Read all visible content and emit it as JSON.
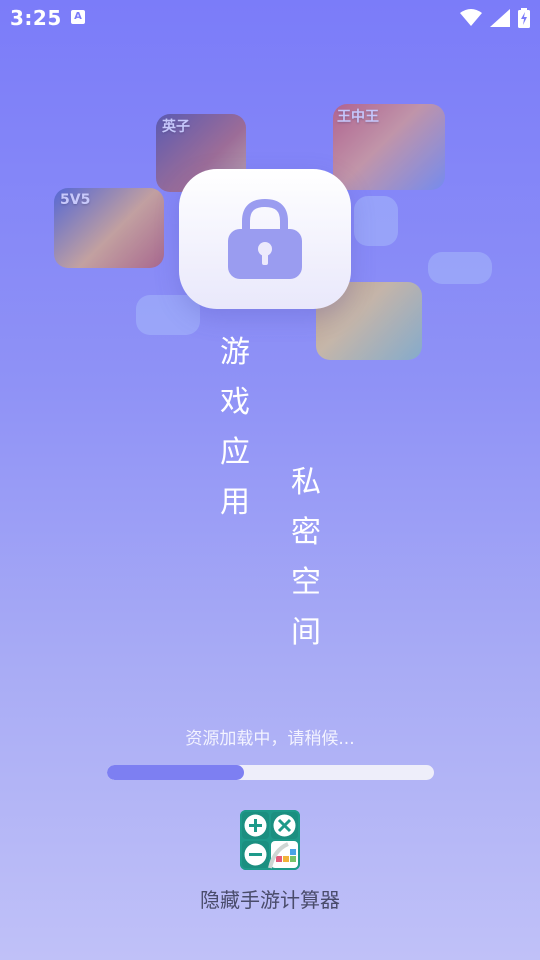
{
  "status_bar": {
    "time": "3:25",
    "notification_icon": "a-icon",
    "notification_letter": "A",
    "icons": [
      "wifi-icon",
      "signal-icon",
      "battery-charging-icon"
    ]
  },
  "background_tiles": [
    {
      "name": "game-tile-1",
      "label": "英子"
    },
    {
      "name": "game-tile-2",
      "label": "王中王"
    },
    {
      "name": "game-tile-3",
      "label": "5V5"
    },
    {
      "name": "game-tile-4",
      "label": ""
    }
  ],
  "lock_icon": "lock-icon",
  "headline": {
    "part1": [
      "游",
      "戏",
      "应",
      "用"
    ],
    "part2": [
      "私",
      "密",
      "空",
      "间"
    ]
  },
  "loading": {
    "text": "资源加载中，请稍候...",
    "progress": 0.42
  },
  "app": {
    "icon": "calculator-app-icon",
    "name": "隐藏手游计算器"
  },
  "colors": {
    "background_top": "#7b7cf9",
    "background_bottom": "#c0c1f8",
    "progress_fill": "#7d7ff2",
    "progress_track": "#eeeefa",
    "lock_glyph": "#9a9cf0",
    "app_name": "#4a4c6b"
  }
}
